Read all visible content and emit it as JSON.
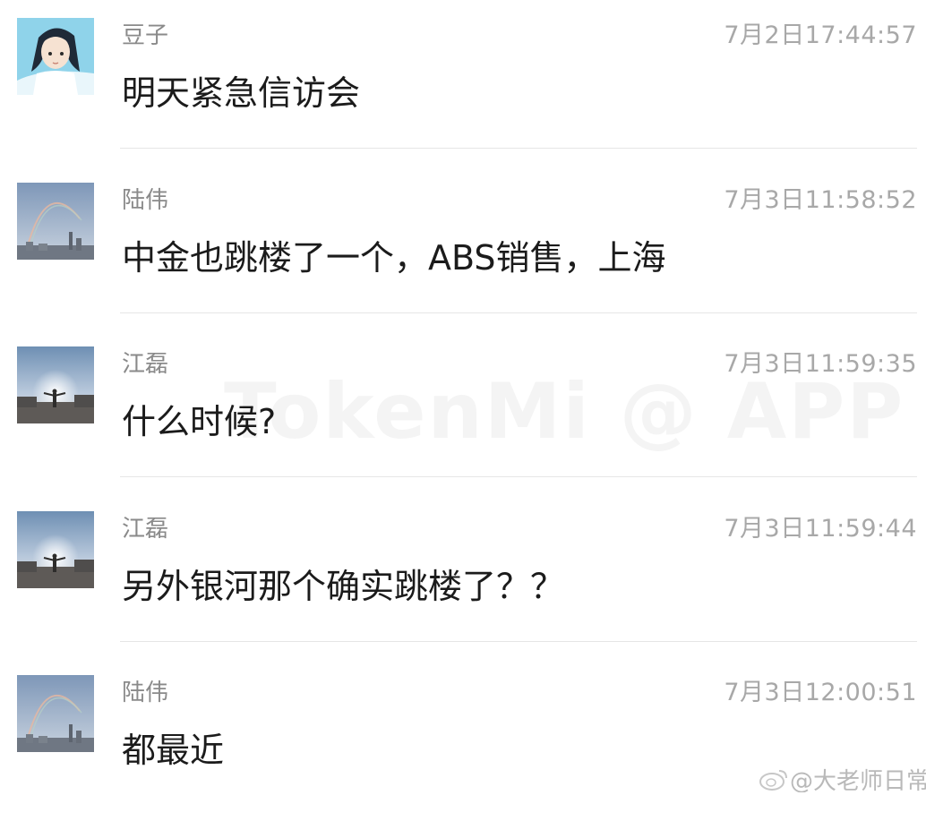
{
  "messages": [
    {
      "sender": "豆子",
      "time": "7月2日17:44:57",
      "text": "明天紧急信访会",
      "avatar": "anime-girl-avatar"
    },
    {
      "sender": "陆伟",
      "time": "7月3日11:58:52",
      "text": "中金也跳楼了一个，ABS销售，上海",
      "avatar": "rainbow-city-avatar"
    },
    {
      "sender": "江磊",
      "time": "7月3日11:59:35",
      "text": "什么时候?",
      "avatar": "sunset-person-avatar"
    },
    {
      "sender": "江磊",
      "time": "7月3日11:59:44",
      "text": "另外银河那个确实跳楼了？？",
      "avatar": "sunset-person-avatar"
    },
    {
      "sender": "陆伟",
      "time": "7月3日12:00:51",
      "text": "都最近",
      "avatar": "rainbow-city-avatar"
    }
  ],
  "watermark": "TokenMi @ APP",
  "weibo_mark": "@大老师日常"
}
